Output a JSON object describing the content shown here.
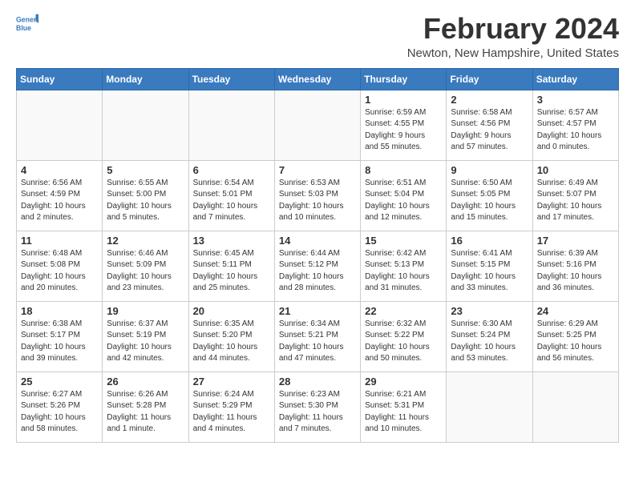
{
  "header": {
    "logo_line1": "General",
    "logo_line2": "Blue",
    "month_title": "February 2024",
    "location": "Newton, New Hampshire, United States"
  },
  "weekdays": [
    "Sunday",
    "Monday",
    "Tuesday",
    "Wednesday",
    "Thursday",
    "Friday",
    "Saturday"
  ],
  "weeks": [
    [
      {
        "day": "",
        "info": ""
      },
      {
        "day": "",
        "info": ""
      },
      {
        "day": "",
        "info": ""
      },
      {
        "day": "",
        "info": ""
      },
      {
        "day": "1",
        "info": "Sunrise: 6:59 AM\nSunset: 4:55 PM\nDaylight: 9 hours\nand 55 minutes."
      },
      {
        "day": "2",
        "info": "Sunrise: 6:58 AM\nSunset: 4:56 PM\nDaylight: 9 hours\nand 57 minutes."
      },
      {
        "day": "3",
        "info": "Sunrise: 6:57 AM\nSunset: 4:57 PM\nDaylight: 10 hours\nand 0 minutes."
      }
    ],
    [
      {
        "day": "4",
        "info": "Sunrise: 6:56 AM\nSunset: 4:59 PM\nDaylight: 10 hours\nand 2 minutes."
      },
      {
        "day": "5",
        "info": "Sunrise: 6:55 AM\nSunset: 5:00 PM\nDaylight: 10 hours\nand 5 minutes."
      },
      {
        "day": "6",
        "info": "Sunrise: 6:54 AM\nSunset: 5:01 PM\nDaylight: 10 hours\nand 7 minutes."
      },
      {
        "day": "7",
        "info": "Sunrise: 6:53 AM\nSunset: 5:03 PM\nDaylight: 10 hours\nand 10 minutes."
      },
      {
        "day": "8",
        "info": "Sunrise: 6:51 AM\nSunset: 5:04 PM\nDaylight: 10 hours\nand 12 minutes."
      },
      {
        "day": "9",
        "info": "Sunrise: 6:50 AM\nSunset: 5:05 PM\nDaylight: 10 hours\nand 15 minutes."
      },
      {
        "day": "10",
        "info": "Sunrise: 6:49 AM\nSunset: 5:07 PM\nDaylight: 10 hours\nand 17 minutes."
      }
    ],
    [
      {
        "day": "11",
        "info": "Sunrise: 6:48 AM\nSunset: 5:08 PM\nDaylight: 10 hours\nand 20 minutes."
      },
      {
        "day": "12",
        "info": "Sunrise: 6:46 AM\nSunset: 5:09 PM\nDaylight: 10 hours\nand 23 minutes."
      },
      {
        "day": "13",
        "info": "Sunrise: 6:45 AM\nSunset: 5:11 PM\nDaylight: 10 hours\nand 25 minutes."
      },
      {
        "day": "14",
        "info": "Sunrise: 6:44 AM\nSunset: 5:12 PM\nDaylight: 10 hours\nand 28 minutes."
      },
      {
        "day": "15",
        "info": "Sunrise: 6:42 AM\nSunset: 5:13 PM\nDaylight: 10 hours\nand 31 minutes."
      },
      {
        "day": "16",
        "info": "Sunrise: 6:41 AM\nSunset: 5:15 PM\nDaylight: 10 hours\nand 33 minutes."
      },
      {
        "day": "17",
        "info": "Sunrise: 6:39 AM\nSunset: 5:16 PM\nDaylight: 10 hours\nand 36 minutes."
      }
    ],
    [
      {
        "day": "18",
        "info": "Sunrise: 6:38 AM\nSunset: 5:17 PM\nDaylight: 10 hours\nand 39 minutes."
      },
      {
        "day": "19",
        "info": "Sunrise: 6:37 AM\nSunset: 5:19 PM\nDaylight: 10 hours\nand 42 minutes."
      },
      {
        "day": "20",
        "info": "Sunrise: 6:35 AM\nSunset: 5:20 PM\nDaylight: 10 hours\nand 44 minutes."
      },
      {
        "day": "21",
        "info": "Sunrise: 6:34 AM\nSunset: 5:21 PM\nDaylight: 10 hours\nand 47 minutes."
      },
      {
        "day": "22",
        "info": "Sunrise: 6:32 AM\nSunset: 5:22 PM\nDaylight: 10 hours\nand 50 minutes."
      },
      {
        "day": "23",
        "info": "Sunrise: 6:30 AM\nSunset: 5:24 PM\nDaylight: 10 hours\nand 53 minutes."
      },
      {
        "day": "24",
        "info": "Sunrise: 6:29 AM\nSunset: 5:25 PM\nDaylight: 10 hours\nand 56 minutes."
      }
    ],
    [
      {
        "day": "25",
        "info": "Sunrise: 6:27 AM\nSunset: 5:26 PM\nDaylight: 10 hours\nand 58 minutes."
      },
      {
        "day": "26",
        "info": "Sunrise: 6:26 AM\nSunset: 5:28 PM\nDaylight: 11 hours\nand 1 minute."
      },
      {
        "day": "27",
        "info": "Sunrise: 6:24 AM\nSunset: 5:29 PM\nDaylight: 11 hours\nand 4 minutes."
      },
      {
        "day": "28",
        "info": "Sunrise: 6:23 AM\nSunset: 5:30 PM\nDaylight: 11 hours\nand 7 minutes."
      },
      {
        "day": "29",
        "info": "Sunrise: 6:21 AM\nSunset: 5:31 PM\nDaylight: 11 hours\nand 10 minutes."
      },
      {
        "day": "",
        "info": ""
      },
      {
        "day": "",
        "info": ""
      }
    ]
  ]
}
